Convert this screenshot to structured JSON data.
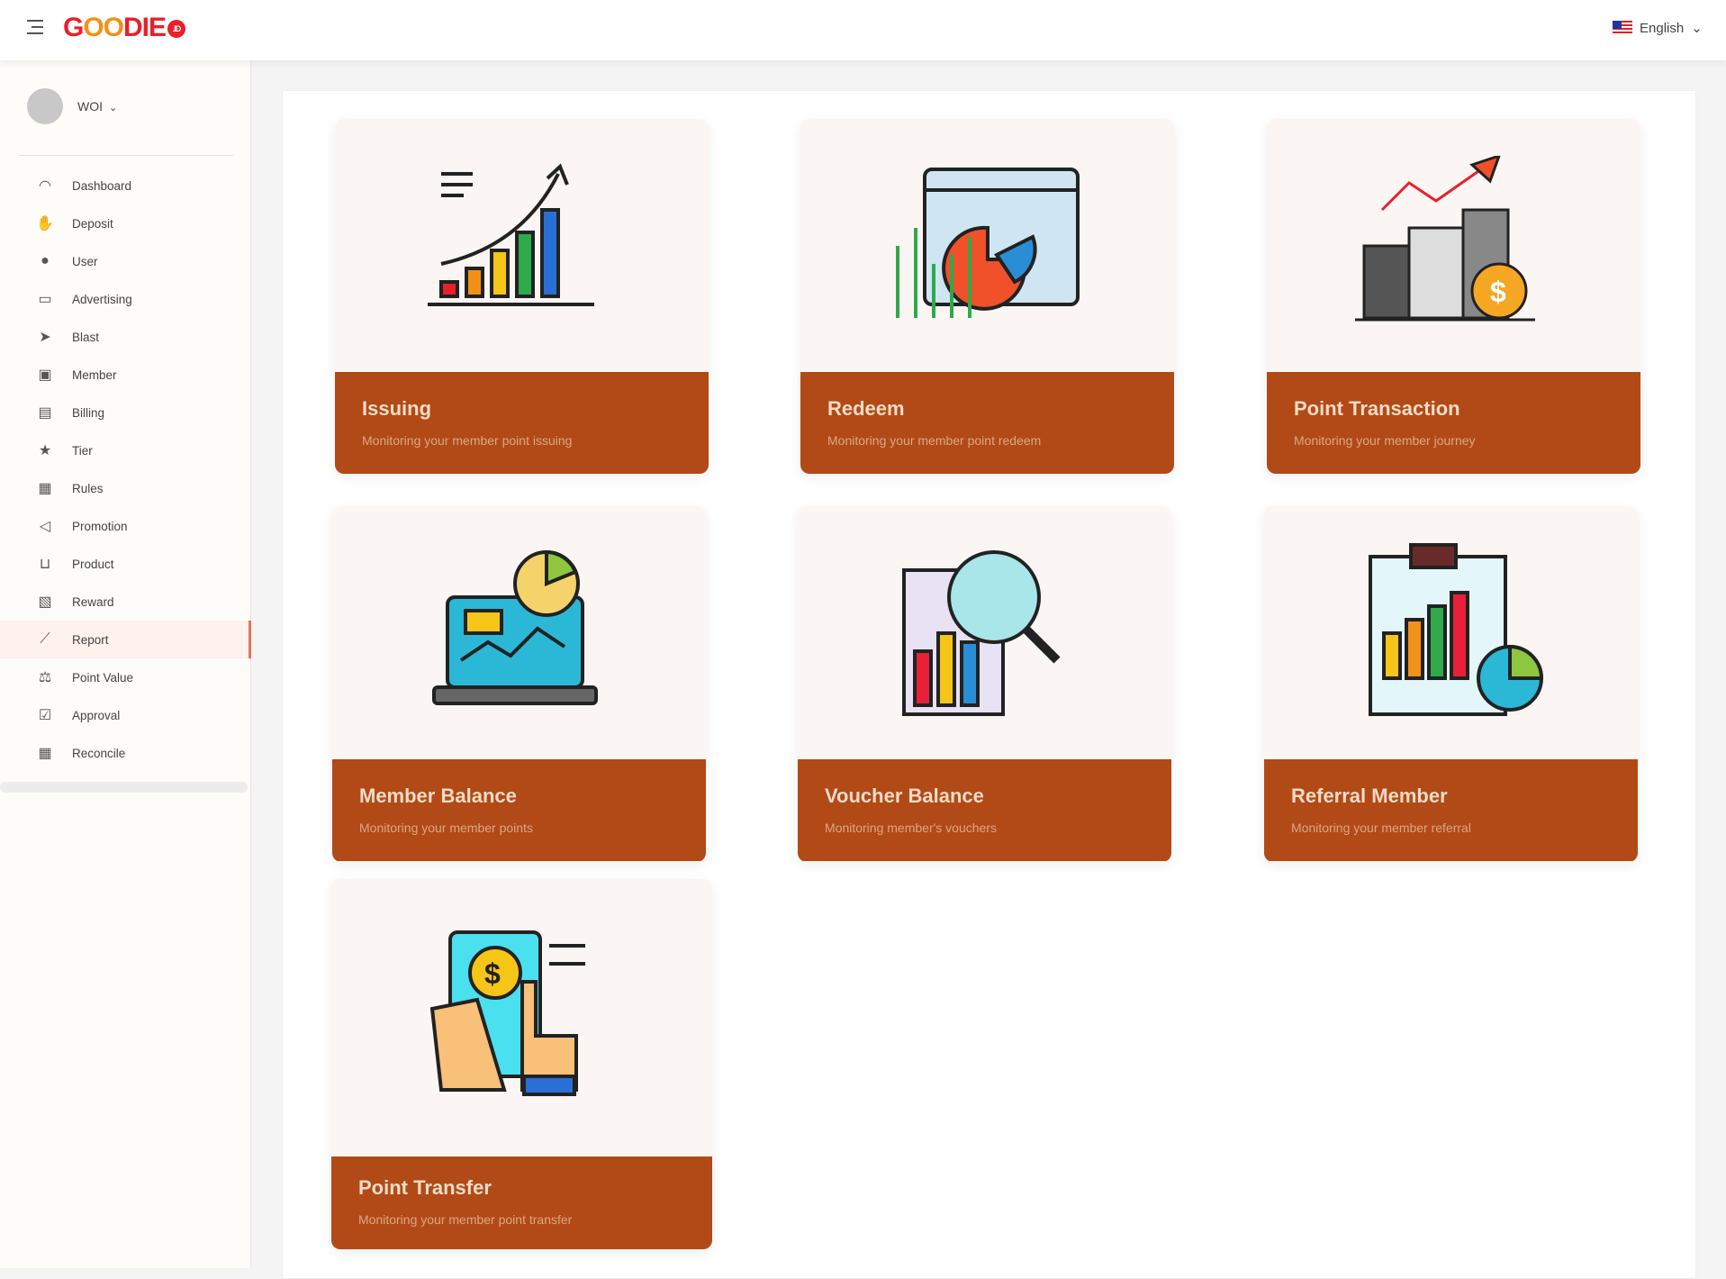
{
  "header": {
    "logo": "GOODIE.ID",
    "language": "English"
  },
  "user": {
    "name": "WOI"
  },
  "sidebar": {
    "items": [
      {
        "label": "Dashboard",
        "icon": "gauge-icon"
      },
      {
        "label": "Deposit",
        "icon": "money-hand-icon"
      },
      {
        "label": "User",
        "icon": "user-icon"
      },
      {
        "label": "Advertising",
        "icon": "ad-card-icon"
      },
      {
        "label": "Blast",
        "icon": "paper-plane-icon"
      },
      {
        "label": "Member",
        "icon": "member-card-icon"
      },
      {
        "label": "Billing",
        "icon": "bill-icon"
      },
      {
        "label": "Tier",
        "icon": "star-icon"
      },
      {
        "label": "Rules",
        "icon": "rules-icon"
      },
      {
        "label": "Promotion",
        "icon": "megaphone-icon"
      },
      {
        "label": "Product",
        "icon": "cart-icon"
      },
      {
        "label": "Reward",
        "icon": "reward-icon"
      },
      {
        "label": "Report",
        "icon": "line-chart-icon",
        "active": true
      },
      {
        "label": "Point Value",
        "icon": "point-value-icon"
      },
      {
        "label": "Approval",
        "icon": "checkbox-icon"
      },
      {
        "label": "Reconcile",
        "icon": "calculator-icon"
      }
    ]
  },
  "cards": [
    {
      "title": "Issuing",
      "subtitle": "Monitoring your member point issuing"
    },
    {
      "title": "Redeem",
      "subtitle": "Monitoring your member point redeem"
    },
    {
      "title": "Point Transaction",
      "subtitle": "Monitoring your member journey"
    },
    {
      "title": "Member Balance",
      "subtitle": "Monitoring your member points"
    },
    {
      "title": "Voucher Balance",
      "subtitle": "Monitoring member's vouchers"
    },
    {
      "title": "Referral Member",
      "subtitle": "Monitoring your member referral"
    },
    {
      "title": "Point Transfer",
      "subtitle": "Monitoring your member point transfer"
    }
  ],
  "colors": {
    "accent": "#b24a17",
    "logo": "#e8202a",
    "active_border": "#e8705c"
  }
}
